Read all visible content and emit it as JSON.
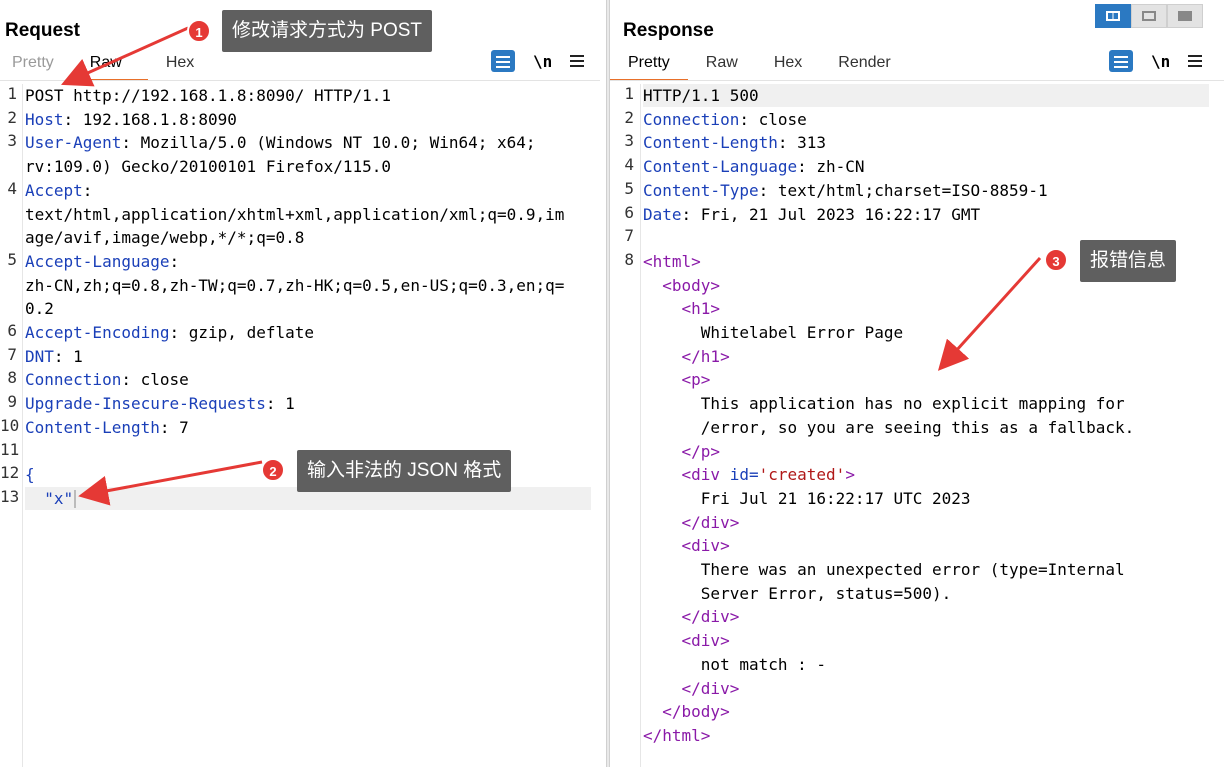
{
  "request": {
    "title": "Request",
    "tabs": [
      "Pretty",
      "Raw",
      "Hex"
    ],
    "newline_label": "\\n",
    "lines": [
      {
        "n": "1",
        "segs": [
          [
            "POST http://192.168.1.8:8090/ HTTP/1.1",
            ""
          ]
        ]
      },
      {
        "n": "2",
        "segs": [
          [
            "Host",
            "hk"
          ],
          [
            ": 192.168.1.8:8090",
            ""
          ]
        ]
      },
      {
        "n": "3",
        "segs": [
          [
            "User-Agent",
            "hk"
          ],
          [
            ": Mozilla/5.0 (Windows NT 10.0; Win64; x64;",
            ""
          ]
        ]
      },
      {
        "n": "",
        "segs": [
          [
            "rv:109.0) Gecko/20100101 Firefox/115.0",
            ""
          ]
        ]
      },
      {
        "n": "4",
        "segs": [
          [
            "Accept",
            "hk"
          ],
          [
            ":",
            ""
          ]
        ]
      },
      {
        "n": "",
        "segs": [
          [
            "text/html,application/xhtml+xml,application/xml;q=0.9,im",
            ""
          ]
        ]
      },
      {
        "n": "",
        "segs": [
          [
            "age/avif,image/webp,*/*;q=0.8",
            ""
          ]
        ]
      },
      {
        "n": "5",
        "segs": [
          [
            "Accept-Language",
            "hk"
          ],
          [
            ":",
            ""
          ]
        ]
      },
      {
        "n": "",
        "segs": [
          [
            "zh-CN,zh;q=0.8,zh-TW;q=0.7,zh-HK;q=0.5,en-US;q=0.3,en;q=",
            ""
          ]
        ]
      },
      {
        "n": "",
        "segs": [
          [
            "0.2",
            ""
          ]
        ]
      },
      {
        "n": "6",
        "segs": [
          [
            "Accept-Encoding",
            "hk"
          ],
          [
            ": gzip, deflate",
            ""
          ]
        ]
      },
      {
        "n": "7",
        "segs": [
          [
            "DNT",
            "hk"
          ],
          [
            ": 1",
            ""
          ]
        ]
      },
      {
        "n": "8",
        "segs": [
          [
            "Connection",
            "hk"
          ],
          [
            ": close",
            ""
          ]
        ]
      },
      {
        "n": "9",
        "segs": [
          [
            "Upgrade-Insecure-Requests",
            "hk"
          ],
          [
            ": 1",
            ""
          ]
        ]
      },
      {
        "n": "10",
        "segs": [
          [
            "Content-Length",
            "hk"
          ],
          [
            ": 7",
            ""
          ]
        ]
      },
      {
        "n": "11",
        "segs": []
      },
      {
        "n": "12",
        "segs": [
          [
            "{",
            "hk"
          ]
        ]
      },
      {
        "n": "13",
        "segs": [
          [
            "  \"x\"",
            "hk"
          ]
        ],
        "cursor": true,
        "highlight": true
      }
    ]
  },
  "response": {
    "title": "Response",
    "tabs": [
      "Pretty",
      "Raw",
      "Hex",
      "Render"
    ],
    "newline_label": "\\n",
    "lines": [
      {
        "n": "1",
        "segs": [
          [
            "HTTP/1.1 500",
            ""
          ]
        ],
        "highlight": true
      },
      {
        "n": "2",
        "segs": [
          [
            "Connection",
            "hk"
          ],
          [
            ": close",
            ""
          ]
        ]
      },
      {
        "n": "3",
        "segs": [
          [
            "Content-Length",
            "hk"
          ],
          [
            ": 313",
            ""
          ]
        ]
      },
      {
        "n": "4",
        "segs": [
          [
            "Content-Language",
            "hk"
          ],
          [
            ": zh-CN",
            ""
          ]
        ]
      },
      {
        "n": "5",
        "segs": [
          [
            "Content-Type",
            "hk"
          ],
          [
            ": text/html;charset=ISO-8859-1",
            ""
          ]
        ]
      },
      {
        "n": "6",
        "segs": [
          [
            "Date",
            "hk"
          ],
          [
            ": Fri, 21 Jul 2023 16:22:17 GMT",
            ""
          ]
        ]
      },
      {
        "n": "7",
        "segs": []
      },
      {
        "n": "8",
        "segs": [
          [
            "<html>",
            "tag"
          ]
        ]
      },
      {
        "n": "",
        "segs": [
          [
            "  ",
            ""
          ],
          [
            "<body>",
            "tag"
          ]
        ]
      },
      {
        "n": "",
        "segs": [
          [
            "    ",
            ""
          ],
          [
            "<h1>",
            "tag"
          ]
        ]
      },
      {
        "n": "",
        "segs": [
          [
            "      Whitelabel Error Page",
            ""
          ]
        ]
      },
      {
        "n": "",
        "segs": [
          [
            "    ",
            ""
          ],
          [
            "</h1>",
            "tag"
          ]
        ]
      },
      {
        "n": "",
        "segs": [
          [
            "    ",
            ""
          ],
          [
            "<p>",
            "tag"
          ]
        ]
      },
      {
        "n": "",
        "segs": [
          [
            "      This application has no explicit mapping for",
            ""
          ]
        ]
      },
      {
        "n": "",
        "segs": [
          [
            "      /error, so you are seeing this as a fallback.",
            ""
          ]
        ]
      },
      {
        "n": "",
        "segs": [
          [
            "    ",
            ""
          ],
          [
            "</p>",
            "tag"
          ]
        ]
      },
      {
        "n": "",
        "segs": [
          [
            "    ",
            ""
          ],
          [
            "<div ",
            "tag"
          ],
          [
            "id=",
            "attr"
          ],
          [
            "'created'",
            "str"
          ],
          [
            ">",
            "tag"
          ]
        ]
      },
      {
        "n": "",
        "segs": [
          [
            "      Fri Jul 21 16:22:17 UTC 2023",
            ""
          ]
        ]
      },
      {
        "n": "",
        "segs": [
          [
            "    ",
            ""
          ],
          [
            "</div>",
            "tag"
          ]
        ]
      },
      {
        "n": "",
        "segs": [
          [
            "    ",
            ""
          ],
          [
            "<div>",
            "tag"
          ]
        ]
      },
      {
        "n": "",
        "segs": [
          [
            "      There was an unexpected error (type=Internal",
            ""
          ]
        ]
      },
      {
        "n": "",
        "segs": [
          [
            "      Server Error, status=500).",
            ""
          ]
        ]
      },
      {
        "n": "",
        "segs": [
          [
            "    ",
            ""
          ],
          [
            "</div>",
            "tag"
          ]
        ]
      },
      {
        "n": "",
        "segs": [
          [
            "    ",
            ""
          ],
          [
            "<div>",
            "tag"
          ]
        ]
      },
      {
        "n": "",
        "segs": [
          [
            "      not match : -",
            ""
          ]
        ]
      },
      {
        "n": "",
        "segs": [
          [
            "    ",
            ""
          ],
          [
            "</div>",
            "tag"
          ]
        ]
      },
      {
        "n": "",
        "segs": [
          [
            "  ",
            ""
          ],
          [
            "</body>",
            "tag"
          ]
        ]
      },
      {
        "n": "",
        "segs": [
          [
            "</html>",
            "tag"
          ]
        ]
      }
    ]
  },
  "annotations": [
    {
      "num": "1",
      "text": "修改请求方式为 POST"
    },
    {
      "num": "2",
      "text": "输入非法的 JSON 格式"
    },
    {
      "num": "3",
      "text": "报错信息"
    }
  ],
  "colors": {
    "annotation_red": "#e53935",
    "callout_bg": "#5f5f5f",
    "accent": "#2b79c2",
    "tab_underline": "#e8702a"
  }
}
